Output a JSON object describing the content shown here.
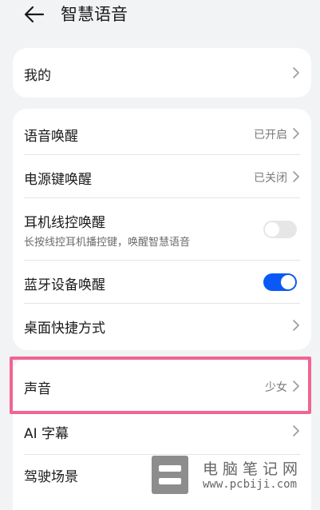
{
  "header": {
    "title": "智慧语音",
    "back_icon": "arrow-left-icon"
  },
  "card1": {
    "items": [
      {
        "label": "我的"
      }
    ]
  },
  "card2": {
    "items": [
      {
        "label": "语音唤醒",
        "value": "已开启"
      },
      {
        "label": "电源键唤醒",
        "value": "已关闭"
      },
      {
        "label": "耳机线控唤醒",
        "sublabel": "长按线控耳机播控键，唤醒智慧语音",
        "toggle": false
      },
      {
        "label": "蓝牙设备唤醒",
        "toggle": true
      },
      {
        "label": "桌面快捷方式"
      }
    ]
  },
  "card3": {
    "items": [
      {
        "label": "声音",
        "value": "少女"
      },
      {
        "label": "AI 字幕"
      },
      {
        "label": "驾驶场景"
      }
    ]
  },
  "colors": {
    "accent": "#0a59f7",
    "highlight": "#f06592"
  },
  "watermark": {
    "text": "电脑笔记网",
    "url": "www.pcbiji.com"
  }
}
